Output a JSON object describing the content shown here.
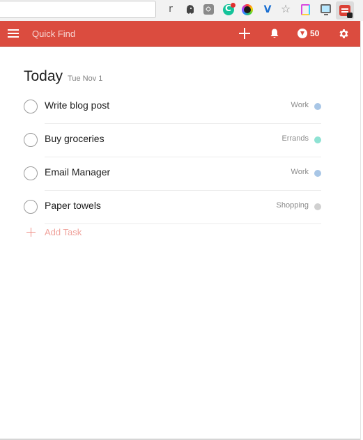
{
  "browser": {
    "extensions": [
      {
        "name": "r-icon",
        "glyph": "r"
      },
      {
        "name": "evernote-icon"
      },
      {
        "name": "pocket-icon"
      },
      {
        "name": "grammarly-icon"
      },
      {
        "name": "color-picker-icon"
      },
      {
        "name": "v-extension-icon",
        "glyph": "V"
      },
      {
        "name": "bookmark-star-icon",
        "glyph": "☆"
      },
      {
        "name": "document-icon"
      },
      {
        "name": "monitor-icon"
      },
      {
        "name": "todoist-extension-icon"
      }
    ]
  },
  "topbar": {
    "search_placeholder": "Quick Find",
    "karma_count": "50",
    "accent_color": "#db4c3f"
  },
  "header": {
    "title": "Today",
    "date": "Tue Nov 1"
  },
  "tasks": [
    {
      "text": "Write blog post",
      "project": "Work",
      "color": "#a8c6e6"
    },
    {
      "text": "Buy groceries",
      "project": "Errands",
      "color": "#8ee2d3"
    },
    {
      "text": "Email Manager",
      "project": "Work",
      "color": "#a8c6e6"
    },
    {
      "text": "Paper towels",
      "project": "Shopping",
      "color": "#d0d0d0"
    }
  ],
  "add_task_label": "Add Task"
}
